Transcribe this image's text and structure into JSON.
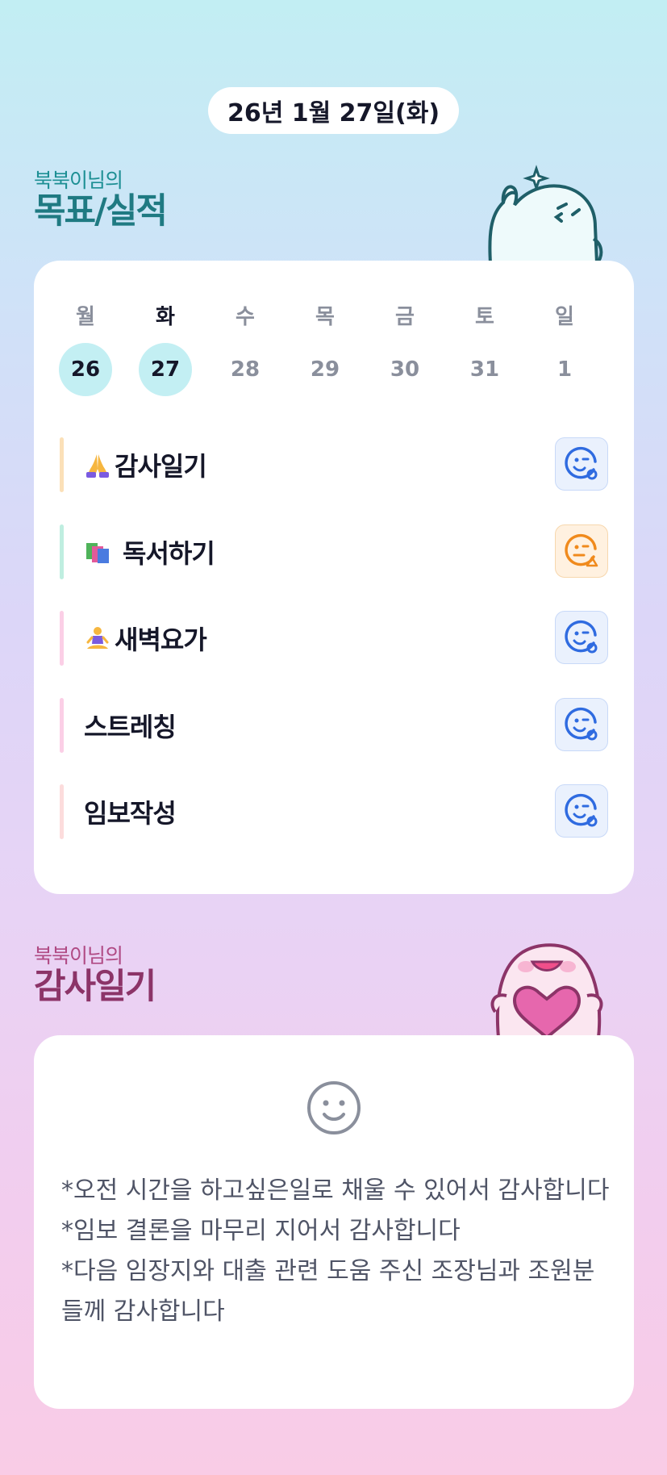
{
  "date": "26년 1월 27일(화)",
  "goals_section": {
    "subtitle": "북북이님의",
    "title": "목표/실적"
  },
  "week": [
    {
      "label": "월",
      "date": "26",
      "done": true,
      "today": false
    },
    {
      "label": "화",
      "date": "27",
      "done": true,
      "today": true
    },
    {
      "label": "수",
      "date": "28",
      "done": false,
      "today": false
    },
    {
      "label": "목",
      "date": "29",
      "done": false,
      "today": false
    },
    {
      "label": "금",
      "date": "30",
      "done": false,
      "today": false
    },
    {
      "label": "토",
      "date": "31",
      "done": false,
      "today": false
    },
    {
      "label": "일",
      "date": "1",
      "done": false,
      "today": false
    }
  ],
  "goals": [
    {
      "name": "감사일기",
      "emoji": "praying-hands-icon",
      "bar_color": "#fbe0b8",
      "status": "completed",
      "status_icon": "smile-check-icon"
    },
    {
      "name": "독서하기",
      "emoji": "books-icon",
      "bar_color": "#bfeee0",
      "status": "partial",
      "status_icon": "smile-warning-icon"
    },
    {
      "name": "새벽요가",
      "emoji": "yoga-person-icon",
      "bar_color": "#fbcfe6",
      "status": "completed",
      "status_icon": "smile-check-icon"
    },
    {
      "name": "스트레칭",
      "emoji": "",
      "bar_color": "#fbcfe6",
      "status": "completed",
      "status_icon": "smile-check-icon"
    },
    {
      "name": "임보작성",
      "emoji": "",
      "bar_color": "#fcdcdc",
      "status": "completed",
      "status_icon": "smile-check-icon"
    }
  ],
  "diary_section": {
    "subtitle": "북북이님의",
    "title": "감사일기"
  },
  "diary": {
    "mood_icon": "smile-face-icon",
    "entries": [
      "*오전 시간을 하고싶은일로 채울 수 있어서 감사합니다",
      "*임보 결론을 마무리 지어서 감사합니다",
      "*다음 임장지와 대출 관련 도움 주신 조장님과 조원분들께 감사합니다"
    ]
  },
  "colors": {
    "completed": "#2f6be0",
    "partial": "#f08a1c",
    "teal": "#1f7a82",
    "magenta": "#8c3468"
  }
}
